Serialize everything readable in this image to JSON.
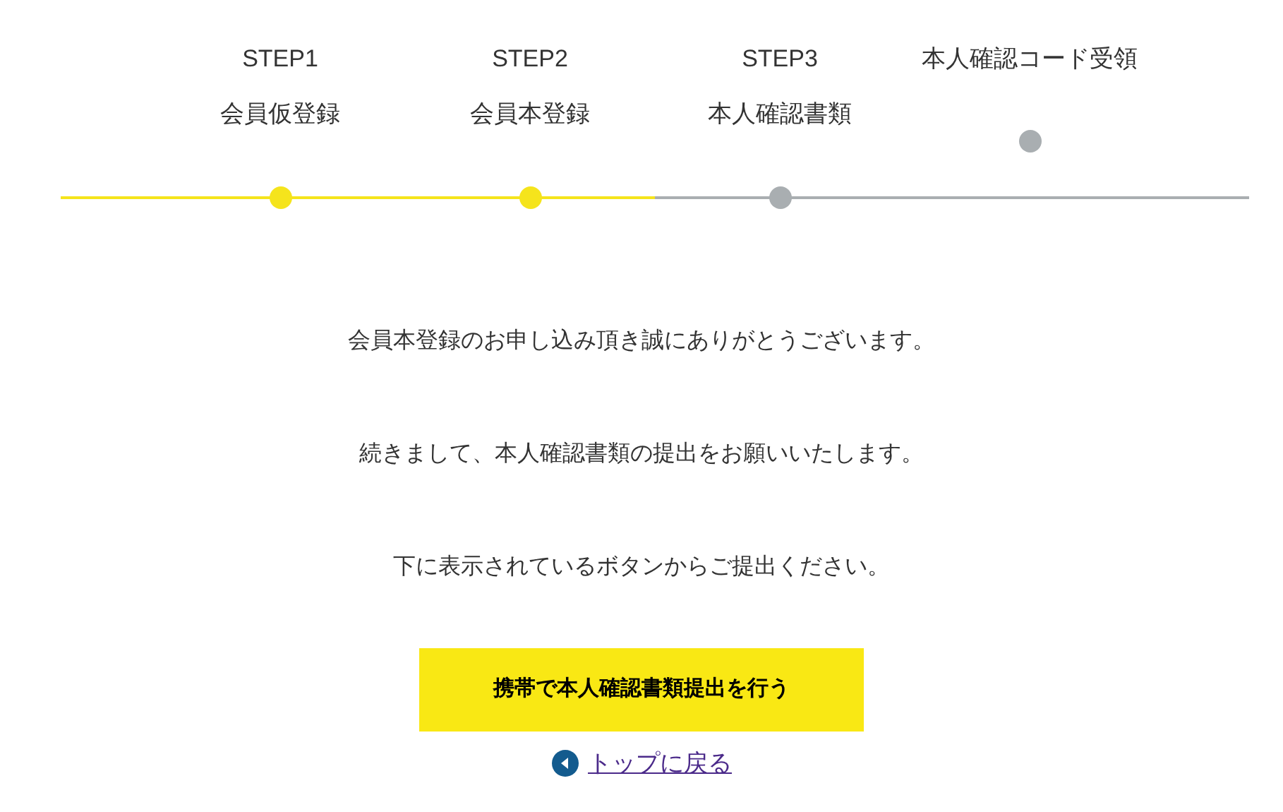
{
  "steps": [
    {
      "kind": "numbered",
      "label": "STEP1",
      "name": "会員仮登録",
      "done": true
    },
    {
      "kind": "numbered",
      "label": "STEP2",
      "name": "会員本登録",
      "done": true
    },
    {
      "kind": "numbered",
      "label": "STEP3",
      "name": "本人確認書類",
      "done": false
    },
    {
      "kind": "final",
      "name": "本人確認コード受領",
      "done": false
    }
  ],
  "messages": [
    "会員本登録のお申し込み頂き誠にありがとうございます。",
    "続きまして、本人確認書類の提出をお願いいたします。",
    "下に表示されているボタンからご提出ください。"
  ],
  "button": "携帯で本人確認書類提出を行う",
  "back_link": "トップに戻る"
}
